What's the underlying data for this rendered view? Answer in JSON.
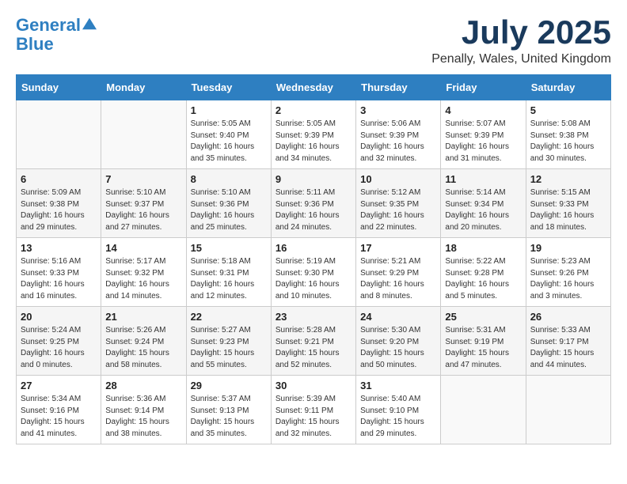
{
  "header": {
    "logo_line1": "General",
    "logo_line2": "Blue",
    "month": "July 2025",
    "location": "Penally, Wales, United Kingdom"
  },
  "days_of_week": [
    "Sunday",
    "Monday",
    "Tuesday",
    "Wednesday",
    "Thursday",
    "Friday",
    "Saturday"
  ],
  "weeks": [
    [
      {
        "num": "",
        "info": ""
      },
      {
        "num": "",
        "info": ""
      },
      {
        "num": "1",
        "info": "Sunrise: 5:05 AM\nSunset: 9:40 PM\nDaylight: 16 hours\nand 35 minutes."
      },
      {
        "num": "2",
        "info": "Sunrise: 5:05 AM\nSunset: 9:39 PM\nDaylight: 16 hours\nand 34 minutes."
      },
      {
        "num": "3",
        "info": "Sunrise: 5:06 AM\nSunset: 9:39 PM\nDaylight: 16 hours\nand 32 minutes."
      },
      {
        "num": "4",
        "info": "Sunrise: 5:07 AM\nSunset: 9:39 PM\nDaylight: 16 hours\nand 31 minutes."
      },
      {
        "num": "5",
        "info": "Sunrise: 5:08 AM\nSunset: 9:38 PM\nDaylight: 16 hours\nand 30 minutes."
      }
    ],
    [
      {
        "num": "6",
        "info": "Sunrise: 5:09 AM\nSunset: 9:38 PM\nDaylight: 16 hours\nand 29 minutes."
      },
      {
        "num": "7",
        "info": "Sunrise: 5:10 AM\nSunset: 9:37 PM\nDaylight: 16 hours\nand 27 minutes."
      },
      {
        "num": "8",
        "info": "Sunrise: 5:10 AM\nSunset: 9:36 PM\nDaylight: 16 hours\nand 25 minutes."
      },
      {
        "num": "9",
        "info": "Sunrise: 5:11 AM\nSunset: 9:36 PM\nDaylight: 16 hours\nand 24 minutes."
      },
      {
        "num": "10",
        "info": "Sunrise: 5:12 AM\nSunset: 9:35 PM\nDaylight: 16 hours\nand 22 minutes."
      },
      {
        "num": "11",
        "info": "Sunrise: 5:14 AM\nSunset: 9:34 PM\nDaylight: 16 hours\nand 20 minutes."
      },
      {
        "num": "12",
        "info": "Sunrise: 5:15 AM\nSunset: 9:33 PM\nDaylight: 16 hours\nand 18 minutes."
      }
    ],
    [
      {
        "num": "13",
        "info": "Sunrise: 5:16 AM\nSunset: 9:33 PM\nDaylight: 16 hours\nand 16 minutes."
      },
      {
        "num": "14",
        "info": "Sunrise: 5:17 AM\nSunset: 9:32 PM\nDaylight: 16 hours\nand 14 minutes."
      },
      {
        "num": "15",
        "info": "Sunrise: 5:18 AM\nSunset: 9:31 PM\nDaylight: 16 hours\nand 12 minutes."
      },
      {
        "num": "16",
        "info": "Sunrise: 5:19 AM\nSunset: 9:30 PM\nDaylight: 16 hours\nand 10 minutes."
      },
      {
        "num": "17",
        "info": "Sunrise: 5:21 AM\nSunset: 9:29 PM\nDaylight: 16 hours\nand 8 minutes."
      },
      {
        "num": "18",
        "info": "Sunrise: 5:22 AM\nSunset: 9:28 PM\nDaylight: 16 hours\nand 5 minutes."
      },
      {
        "num": "19",
        "info": "Sunrise: 5:23 AM\nSunset: 9:26 PM\nDaylight: 16 hours\nand 3 minutes."
      }
    ],
    [
      {
        "num": "20",
        "info": "Sunrise: 5:24 AM\nSunset: 9:25 PM\nDaylight: 16 hours\nand 0 minutes."
      },
      {
        "num": "21",
        "info": "Sunrise: 5:26 AM\nSunset: 9:24 PM\nDaylight: 15 hours\nand 58 minutes."
      },
      {
        "num": "22",
        "info": "Sunrise: 5:27 AM\nSunset: 9:23 PM\nDaylight: 15 hours\nand 55 minutes."
      },
      {
        "num": "23",
        "info": "Sunrise: 5:28 AM\nSunset: 9:21 PM\nDaylight: 15 hours\nand 52 minutes."
      },
      {
        "num": "24",
        "info": "Sunrise: 5:30 AM\nSunset: 9:20 PM\nDaylight: 15 hours\nand 50 minutes."
      },
      {
        "num": "25",
        "info": "Sunrise: 5:31 AM\nSunset: 9:19 PM\nDaylight: 15 hours\nand 47 minutes."
      },
      {
        "num": "26",
        "info": "Sunrise: 5:33 AM\nSunset: 9:17 PM\nDaylight: 15 hours\nand 44 minutes."
      }
    ],
    [
      {
        "num": "27",
        "info": "Sunrise: 5:34 AM\nSunset: 9:16 PM\nDaylight: 15 hours\nand 41 minutes."
      },
      {
        "num": "28",
        "info": "Sunrise: 5:36 AM\nSunset: 9:14 PM\nDaylight: 15 hours\nand 38 minutes."
      },
      {
        "num": "29",
        "info": "Sunrise: 5:37 AM\nSunset: 9:13 PM\nDaylight: 15 hours\nand 35 minutes."
      },
      {
        "num": "30",
        "info": "Sunrise: 5:39 AM\nSunset: 9:11 PM\nDaylight: 15 hours\nand 32 minutes."
      },
      {
        "num": "31",
        "info": "Sunrise: 5:40 AM\nSunset: 9:10 PM\nDaylight: 15 hours\nand 29 minutes."
      },
      {
        "num": "",
        "info": ""
      },
      {
        "num": "",
        "info": ""
      }
    ]
  ]
}
